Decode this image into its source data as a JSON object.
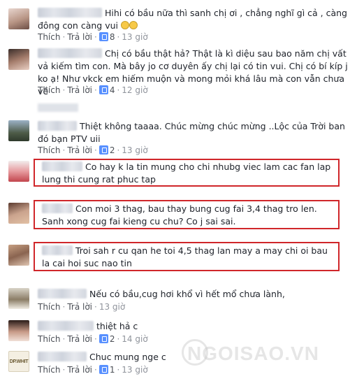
{
  "comments": [
    {
      "text": "Hihi có bầu nữa thì sanh chị ơi , chẳng nghĩ gì cả , càng đông con càng vui",
      "like_label": "Thích",
      "reply_label": "Trả lời",
      "likes": "8",
      "time": "13 giờ"
    },
    {
      "text": "Chị có bầu thật hả? Thật là kì diệu sau bao năm chị vất vả kiếm tìm con. Mà bây jo cơ duyên ấy chị lại có tin vui. Chị có bí kíp j ko ạ! Như vkck em hiếm muộn và mong mỏi khá lâu mà con vẫn chưa về",
      "like_label": "Thích",
      "reply_label": "Trả lời",
      "likes": "4",
      "time": "12 giờ"
    },
    {
      "text": "Thiệt không taaaa. Chúc mừng chúc mừng ..Lộc của Trời ban đó bạn PTV uii",
      "like_label": "Thích",
      "reply_label": "Trả lời",
      "likes": "2",
      "time": "13 giờ"
    },
    {
      "text": "Co hay k la tin mung cho chi nhubg viec lam cac fan lap lung thi cung rat phuc tap",
      "like_label": "",
      "reply_label": "",
      "likes": "",
      "time": ""
    },
    {
      "text": "Con moi 3 thag, bau thay bung cug fai 3,4 thag tro len. Sanh xong cug fai kieng cu chu? Co j sai sai.",
      "like_label": "",
      "reply_label": "",
      "likes": "",
      "time": ""
    },
    {
      "text": "Troi sah r cu qan he toi 4,5 thag lan may a may chi oi bau la cai hoi suc nao tin",
      "like_label": "",
      "reply_label": "",
      "likes": "",
      "time": ""
    },
    {
      "text": "Nếu có bầu,cug hơi khổ vì hết mổ chưa lành,",
      "like_label": "Thích",
      "reply_label": "Trả lời",
      "likes": "",
      "time": "13 giờ"
    },
    {
      "text": "thiệt hả c",
      "like_label": "Thích",
      "reply_label": "Trả lời",
      "likes": "2",
      "time": "14 giờ"
    },
    {
      "text": "Chuc mung nge c",
      "like_label": "Thích",
      "reply_label": "Trả lời",
      "likes": "1",
      "time": "13 giờ"
    }
  ],
  "watermark": "NGOISAO.VN",
  "avatar_badge_text": "DP.WHIT",
  "colors": {
    "link": "#4b4f56",
    "meta": "#90949c",
    "like_badge": "#5890ff",
    "highlight_border": "#d0262a"
  }
}
